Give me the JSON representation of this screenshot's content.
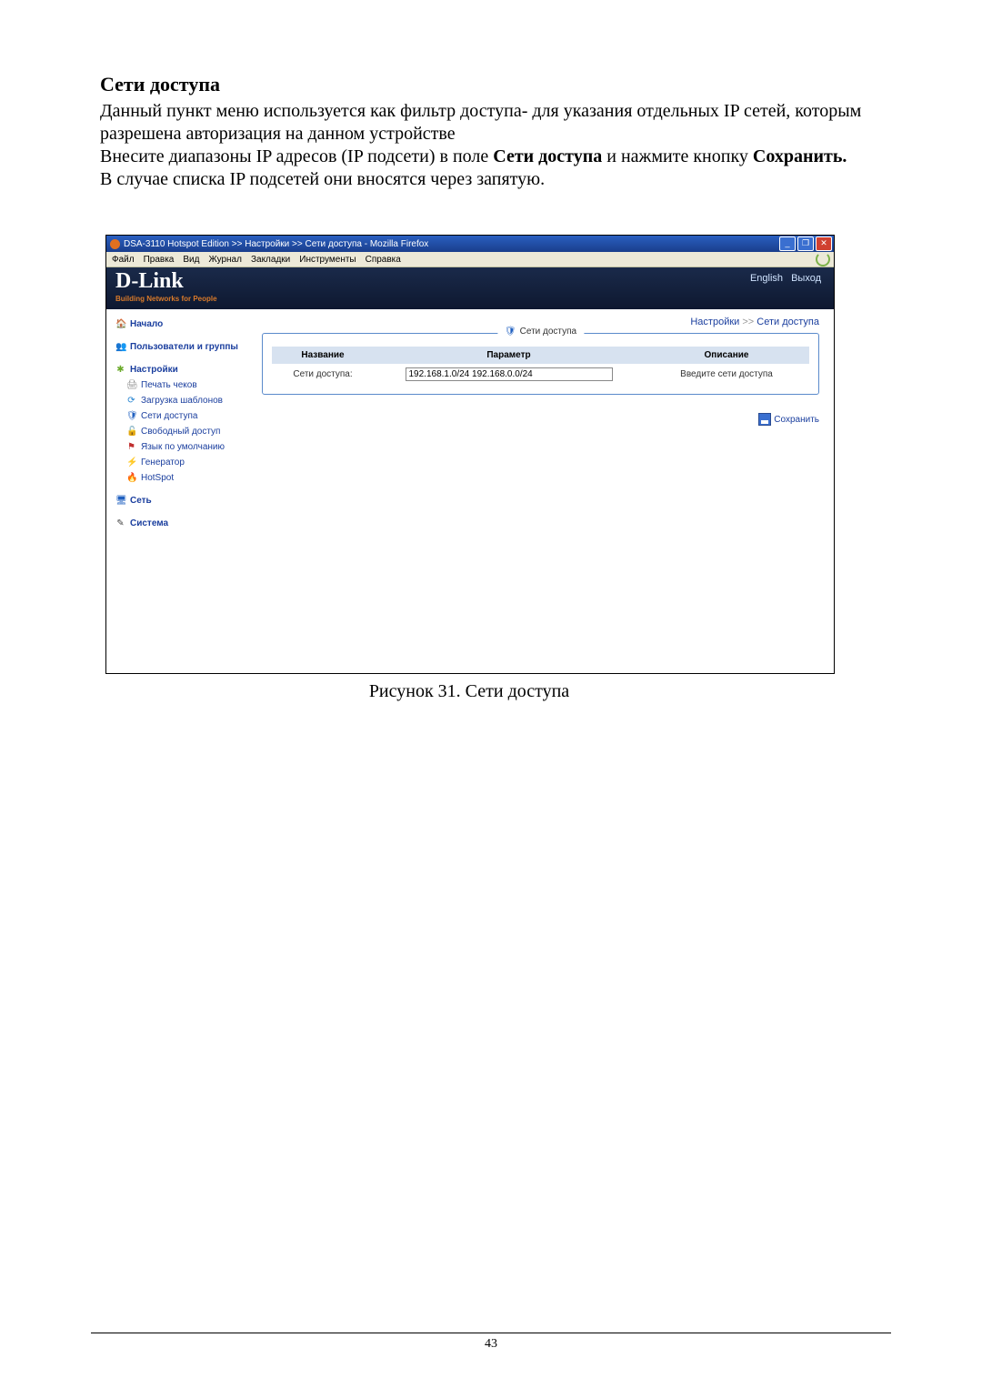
{
  "doc": {
    "heading": "Сети доступа",
    "p1": "Данный пункт меню используется  как фильтр доступа- для указания отдельных IP сетей, которым разрешена авторизация на данном устройстве",
    "p2_a": "Внесите диапазоны IP адресов (IP подсети) в поле ",
    "p2_b": "Сети доступа",
    "p2_c": " и нажмите кнопку ",
    "p2_d": "Сохранить.",
    "p3": "В случае списка IP подсетей они вносятся через запятую.",
    "figure_caption": "Рисунок 31. Сети доступа",
    "page_number": "43"
  },
  "browser": {
    "title": "DSA-3110 Hotspot Edition >> Настройки >> Сети доступа - Mozilla Firefox",
    "menus": {
      "file": "Файл",
      "edit": "Правка",
      "view": "Вид",
      "history": "Журнал",
      "bookmarks": "Закладки",
      "tools": "Инструменты",
      "help": "Справка"
    },
    "winbtn_min": "_",
    "winbtn_max": "❐",
    "winbtn_close": "✕"
  },
  "ui": {
    "logo": "D-Link",
    "tagline": "Building Networks for People",
    "header_links": {
      "english": "English",
      "logout": "Выход"
    },
    "breadcrumb": {
      "a": "Настройки",
      "sep": ">>",
      "b": "Сети доступа"
    },
    "sidebar": {
      "home": "Начало",
      "users": "Пользователи и группы",
      "settings": "Настройки",
      "print": "Печать чеков",
      "templates": "Загрузка шаблонов",
      "access_nets": "Сети доступа",
      "free_access": "Свободный доступ",
      "default_lang": "Язык по умолчанию",
      "generator": "Генератор",
      "hotspot": "HotSpot",
      "network": "Сеть",
      "system": "Система"
    },
    "panel": {
      "legend": "Сети доступа",
      "th_name": "Название",
      "th_param": "Параметр",
      "th_desc": "Описание",
      "row_name": "Сети доступа:",
      "row_value": "192.168.1.0/24 192.168.0.0/24",
      "row_desc": "Введите сети доступа",
      "save": "Сохранить"
    }
  }
}
